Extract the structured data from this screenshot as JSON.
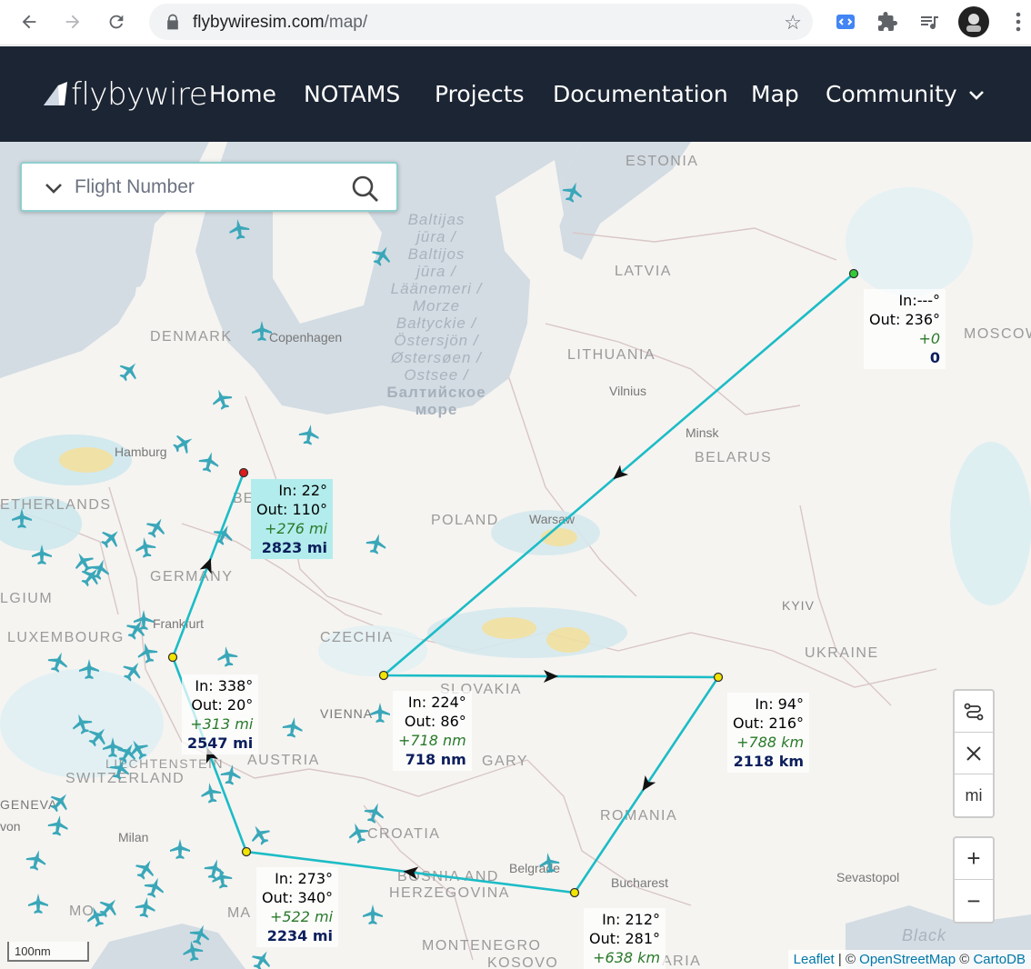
{
  "browser": {
    "url_host": "flybywiresim.com",
    "url_path": "/map/",
    "icons": [
      "back-icon",
      "forward-icon",
      "reload-icon",
      "lock-icon",
      "bookmark-star-icon",
      "extension-icon",
      "puzzle-icon",
      "media-icon",
      "avatar",
      "menu-icon"
    ]
  },
  "site": {
    "brand": "flybywire",
    "nav": [
      "Home",
      "NOTAMS",
      "Projects",
      "Documentation",
      "Map",
      "Community"
    ]
  },
  "search": {
    "placeholder": "Flight Number"
  },
  "map_labels": {
    "countries": [
      "ESTONIA",
      "LATVIA",
      "LITHUANIA",
      "DENMARK",
      "BELARUS",
      "POLAND",
      "GERMANY",
      "CZECHIA",
      "UKRAINE",
      "LUXEMBOURG",
      "AUSTRIA",
      "SWITZERLAND",
      "ROMANIA",
      "CROATIA",
      "MONTENEGRO",
      "KOSOVO",
      "ETHERLANDS",
      "LGIUM",
      "SLOVAKIA",
      "BOSNIA AND HERZEGOVINA",
      "MOSCOW",
      "LIECHTENSTEIN",
      "GARY",
      "ARIA"
    ],
    "cities": [
      "Copenhagen",
      "Hamburg",
      "Vilnius",
      "Minsk",
      "Warsaw",
      "KYIV",
      "Frankfurt",
      "VIENNA",
      "Milan",
      "Belgrade",
      "Bucharest",
      "Sevastopol",
      "GENEVA",
      "BE",
      "MO",
      "MA",
      "von"
    ],
    "sea": [
      "Baltijas",
      "jūra /",
      "Baltijos",
      "jūra /",
      "Läänemeri /",
      "Morze",
      "Bałtyckie /",
      "Östersjön /",
      "Østersøen /",
      "Ostsee /",
      "Балтийское",
      "море"
    ],
    "sea_right": "Black"
  },
  "route_labels": [
    {
      "in": "In:---°",
      "out": "Out: 236°",
      "rel": "+0",
      "cum": "0"
    },
    {
      "in": "In: 22°",
      "out": "Out: 110°",
      "rel": "+276 mi",
      "cum": "2823 mi"
    },
    {
      "in": "In: 338°",
      "out": "Out: 20°",
      "rel": "+313 mi",
      "cum": "2547 mi"
    },
    {
      "in": "In: 224°",
      "out": "Out: 86°",
      "rel": "+718 nm",
      "cum": "718 nm"
    },
    {
      "in": "In: 94°",
      "out": "Out: 216°",
      "rel": "+788 km",
      "cum": "2118 km"
    },
    {
      "in": "In: 273°",
      "out": "Out: 340°",
      "rel": "+522 mi",
      "cum": "2234 mi"
    },
    {
      "in": "In: 212°",
      "out": "Out: 281°",
      "rel": "+638 km",
      "cum": ""
    }
  ],
  "controls": {
    "unit": "mi",
    "zoom_in": "+",
    "zoom_out": "−"
  },
  "scale": "100nm",
  "attribution": {
    "leaflet": "Leaflet",
    "sep1": " | © ",
    "osm": "OpenStreetMap",
    "sep2": " © ",
    "carto": "CartoDB"
  },
  "colors": {
    "route": "#1cbcc6",
    "header_bg": "#1c2533",
    "plane": "#3aa7b9",
    "start": "#2fcc3a",
    "end": "#dd1c1c",
    "waypoint": "#f3e400"
  }
}
